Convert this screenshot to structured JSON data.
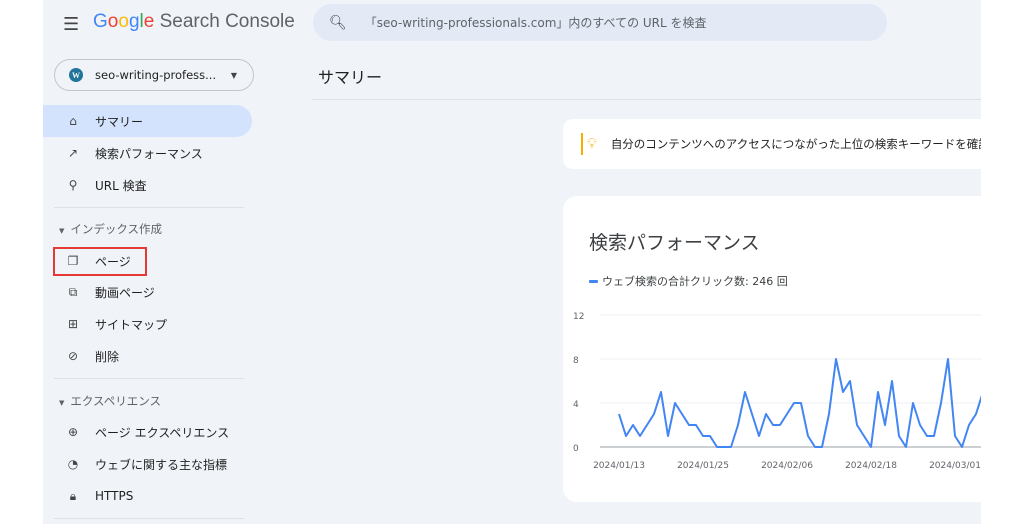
{
  "header": {
    "product": "Search Console",
    "logo_letters": [
      "G",
      "o",
      "o",
      "g",
      "l",
      "e"
    ],
    "search_placeholder": "「seo-writing-professionals.com」内のすべての URL を検査"
  },
  "property": {
    "name": "seo-writing-profess..."
  },
  "sidebar": {
    "top": [
      {
        "label": "サマリー",
        "icon": "home-icon",
        "active": true
      },
      {
        "label": "検索パフォーマンス",
        "icon": "trending-up-icon"
      },
      {
        "label": "URL 検査",
        "icon": "search-icon"
      }
    ],
    "sections": [
      {
        "title": "インデックス作成",
        "items": [
          {
            "label": "ページ",
            "icon": "pages-icon",
            "highlighted": true
          },
          {
            "label": "動画ページ",
            "icon": "video-pages-icon"
          },
          {
            "label": "サイトマップ",
            "icon": "sitemap-icon"
          },
          {
            "label": "削除",
            "icon": "removals-icon"
          }
        ]
      },
      {
        "title": "エクスペリエンス",
        "items": [
          {
            "label": "ページ エクスペリエンス",
            "icon": "page-experience-icon"
          },
          {
            "label": "ウェブに関する主な指標",
            "icon": "speed-gauge-icon"
          },
          {
            "label": "HTTPS",
            "icon": "lock-icon"
          }
        ]
      }
    ]
  },
  "main": {
    "title": "サマリー",
    "tip": "自分のコンテンツへのアクセスにつながった上位の検索キーワードを確認",
    "card_title": "検索パフォーマンス",
    "legend": "ウェブ検索の合計クリック数: 246 回"
  },
  "colors": {
    "line": "#4285f4",
    "highlight": "#e53935",
    "active_nav": "#d3e3fd"
  },
  "chart_data": {
    "type": "line",
    "ylim": [
      0,
      12
    ],
    "yticks": [
      0,
      4,
      8,
      12
    ],
    "grid": true,
    "xticks": [
      "2024/01/13",
      "2024/01/25",
      "2024/02/06",
      "2024/02/18",
      "2024/03/01"
    ],
    "start_date": "2024/01/13",
    "series": [
      {
        "name": "ウェブ検索の合計クリック数",
        "values": [
          3,
          1,
          2,
          1,
          2,
          3,
          5,
          1,
          4,
          3,
          2,
          2,
          1,
          1,
          0,
          0,
          0,
          2,
          5,
          3,
          1,
          3,
          2,
          2,
          3,
          4,
          4,
          1,
          0,
          0,
          3,
          8,
          5,
          6,
          2,
          1,
          0,
          5,
          2,
          6,
          1,
          0,
          4,
          2,
          1,
          1,
          4,
          8,
          1,
          0,
          2,
          3,
          5
        ]
      }
    ]
  }
}
